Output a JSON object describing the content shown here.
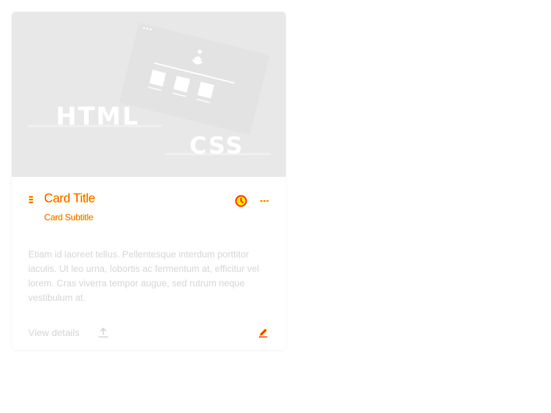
{
  "hero": {
    "html_word": "HTML",
    "css_word": "CSS"
  },
  "card": {
    "title": "Card Title",
    "subtitle": "Card Subtitle",
    "body": "Etiam id laoreet tellus. Pellentesque interdum porttitor iaculis. Ut leo urna, lobortis ac fermentum at, efficitur vel lorem. Cras viverra tempor augue, sed rutrum neque vestibulum at.",
    "view_details_label": "View details"
  },
  "icons": {
    "drag": "drag-handle-icon",
    "clock": "clock-icon",
    "more": "more-options-icon",
    "share": "share-upload-icon",
    "edit": "edit-pencil-icon"
  },
  "colors": {
    "hero_background": "#e8e8e8",
    "title_fill": "#ff2a00",
    "title_outline": "#ffe600",
    "muted_text": "#d6d6d6"
  }
}
